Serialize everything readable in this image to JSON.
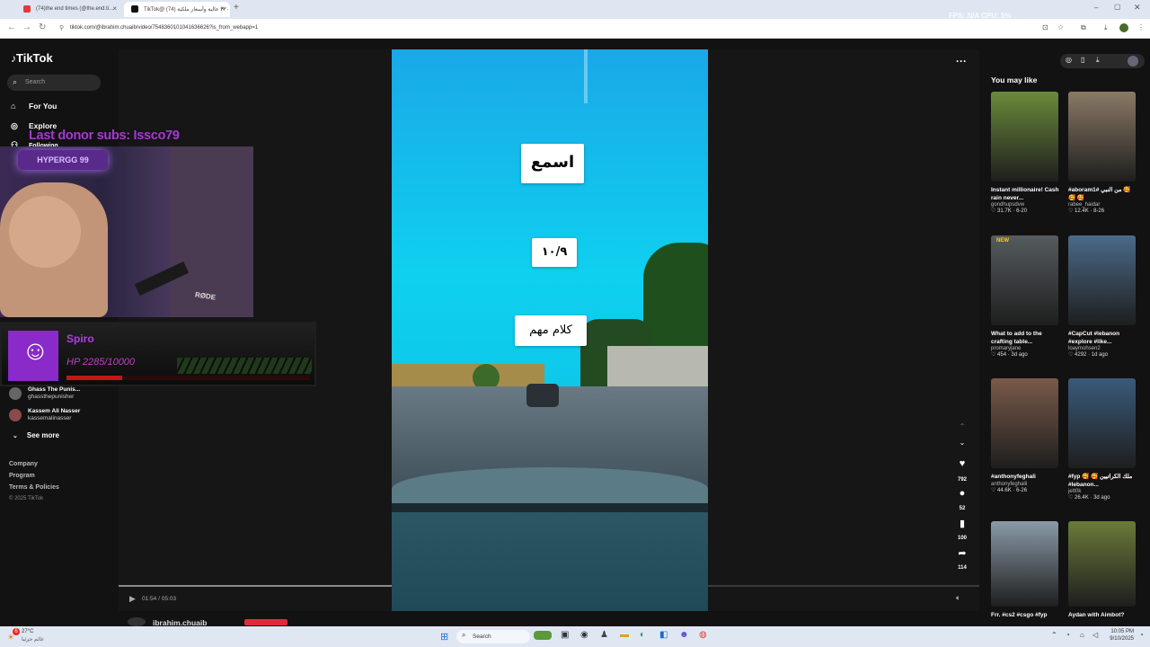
{
  "browser": {
    "tabs": [
      {
        "label": "(74)the end times (@the.end.ti..."
      },
      {
        "label": "TikTok@ ٣٣٠ عالية وأسعار ملكية (74)"
      }
    ],
    "new_tab": "+",
    "url": "tiktok.com/@ibrahim.chuaib/video/7548360101041636626?is_from_webapp=1",
    "stream_overlay_text": "FPS: N/A   CPU: 5%"
  },
  "tiktok": {
    "logo": "TikTok",
    "search_placeholder": "Search",
    "nav": [
      {
        "label": "For You",
        "icon": "home-icon"
      },
      {
        "label": "Explore",
        "icon": "compass-icon"
      },
      {
        "label": "Following",
        "icon": "people-icon"
      }
    ],
    "following_accounts": [
      {
        "name": "Ghass The Punis...",
        "handle": "ghassthepunisher"
      },
      {
        "name": "Kassem Ali Nasser",
        "handle": "kassemalinasser"
      }
    ],
    "see_more": "See more",
    "footer_links": [
      "Company",
      "Program",
      "Terms & Policies"
    ],
    "copyright": "© 2025 TikTok",
    "more_menu": "···"
  },
  "video": {
    "overlay_texts": [
      "اسمع",
      "١٠/٩",
      "كلام مهم"
    ],
    "time_current": "01:54",
    "time_total": "05:03",
    "progress": 0.376,
    "author": "ibrahim.chuaib",
    "likes": "792",
    "comments": "52",
    "saves": "100",
    "shares": "114"
  },
  "recommendations": {
    "heading": "You may like",
    "items": [
      {
        "title": "Instant millionaire! Cash rain never...",
        "user": "gondhupsdvw",
        "likes": "31.7K",
        "date": "6-20",
        "thumb": "#6a8a3a"
      },
      {
        "title": "#aboram1# من النبي 🥰 🥰 🥰",
        "user": "rabee_haidar",
        "likes": "12.4K",
        "date": "8-26",
        "thumb": "#8a7a66"
      },
      {
        "title": "What to add to the crafting table...",
        "user": "promaryjane",
        "likes": "454",
        "date": "3d ago",
        "thumb": "#555b5e"
      },
      {
        "title": "#CapCut #lebanon #explore #like...",
        "user": "loaymohsen2",
        "likes": "4292",
        "date": "1d ago",
        "thumb": "#4b6a88"
      },
      {
        "title": "#anthonyfeghali",
        "user": "anthonyfeghalii",
        "likes": "44.6K",
        "date": "6-26",
        "thumb": "#7a5a4a"
      },
      {
        "title": "#fyp 🥰 🥰 ملك الكراتيين #lebanon...",
        "user": "jett0k",
        "likes": "26.4K",
        "date": "3d ago",
        "thumb": "#3a5a7a"
      },
      {
        "title": "Frr. #cs2 #csgo #fyp",
        "user": "",
        "likes": "",
        "date": "",
        "thumb": "#8a9aa8"
      },
      {
        "title": "Aydan with Aimbot?",
        "user": "",
        "likes": "",
        "date": "",
        "thumb": "#6a7a3a"
      }
    ],
    "new_badge": "NEW"
  },
  "stream": {
    "donor_text": "Last donor subs: Issco79",
    "cam_sign": "HYPERGG 99",
    "mic_brand": "RØDE",
    "hp_name": "Spiro",
    "hp_text": "HP 2285/10000",
    "hp_fraction": 0.2285
  },
  "taskbar": {
    "weather_temp": "27°C",
    "weather_desc": "غائم جزئيا",
    "search": "Search",
    "time": "10:05 PM",
    "date": "9/10/2025",
    "notification_count": "6"
  }
}
